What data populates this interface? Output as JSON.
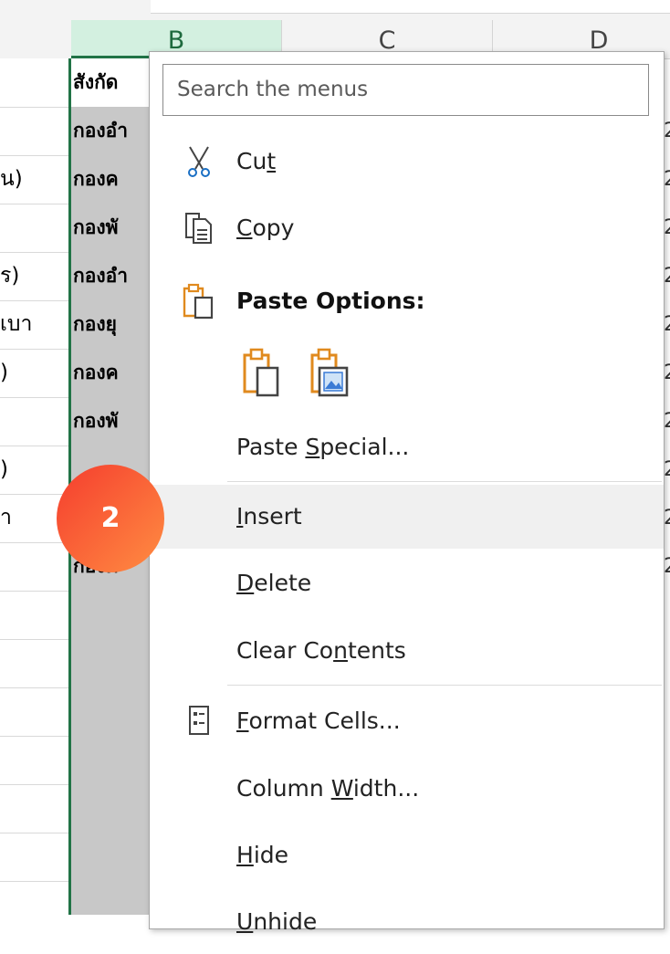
{
  "columns": {
    "b": "B",
    "c": "C",
    "d": "D"
  },
  "rows": [
    {
      "a": "",
      "b": "สังกัด",
      "d": ""
    },
    {
      "a": "",
      "b": "กองอำ",
      "d": "2"
    },
    {
      "a": "น)",
      "b": "กองค",
      "d": "2"
    },
    {
      "a": "",
      "b": "กองพั",
      "d": "2"
    },
    {
      "a": "ร)",
      "b": "กองอำ",
      "d": "2"
    },
    {
      "a": "เบา",
      "b": "กองยุ",
      "d": "2"
    },
    {
      "a": ")",
      "b": "กองค",
      "d": "2"
    },
    {
      "a": "",
      "b": "กองพั",
      "d": "2"
    },
    {
      "a": ")",
      "b": "",
      "d": "2"
    },
    {
      "a": "า",
      "b": "",
      "d": "2"
    },
    {
      "a": "",
      "b": "กองค",
      "d": "2"
    }
  ],
  "menu": {
    "search_placeholder": "Search the menus",
    "cut": {
      "before": "Cu",
      "ul": "t",
      "after": ""
    },
    "copy": {
      "before": "",
      "ul": "C",
      "after": "opy"
    },
    "paste_options": "Paste Options:",
    "paste_special": {
      "before": "Paste ",
      "ul": "S",
      "after": "pecial..."
    },
    "insert": {
      "before": "",
      "ul": "I",
      "after": "nsert"
    },
    "delete": {
      "before": "",
      "ul": "D",
      "after": "elete"
    },
    "clear_contents": {
      "before": "Clear Co",
      "ul": "n",
      "after": "tents"
    },
    "format_cells": {
      "before": "",
      "ul": "F",
      "after": "ormat Cells..."
    },
    "column_width": {
      "before": "Column ",
      "ul": "W",
      "after": "idth..."
    },
    "hide": {
      "before": "",
      "ul": "H",
      "after": "ide"
    },
    "unhide": {
      "before": "",
      "ul": "U",
      "after": "nhide"
    }
  },
  "badge": "2",
  "colors": {
    "accent_green": "#217346",
    "badge_start": "#f53d2e",
    "badge_end": "#ff8d42",
    "paste_orange": "#e08a1e"
  }
}
